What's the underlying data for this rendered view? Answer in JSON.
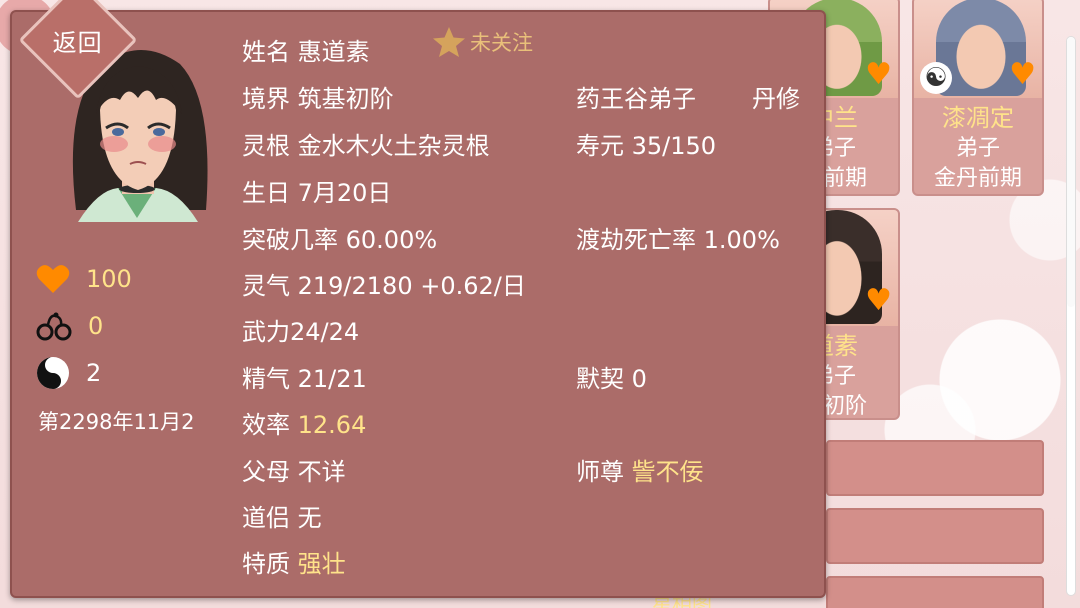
{
  "background": {
    "cards": [
      {
        "name": "中兰",
        "role": "弟子",
        "rank": "丹前期"
      },
      {
        "name": "漆凋定",
        "role": "弟子",
        "rank": "金丹前期"
      },
      {
        "name": "道素",
        "role": "弟子",
        "rank": "基初阶"
      }
    ],
    "bottom_peek": "星相图"
  },
  "panel": {
    "back_label": "返回",
    "follow_label": "未关注",
    "left_stats": {
      "favor": "100",
      "bond": "0",
      "daoyin": "2",
      "date": "第2298年11月2"
    },
    "info": {
      "name": "姓名 惠道素",
      "realm": "境界 筑基初阶",
      "sect": "药王谷弟子",
      "profession": "丹修",
      "root": "灵根 金水木火土杂灵根",
      "lifespan": "寿元 35/150",
      "birthday": "生日 7月20日",
      "breakthrough": "突破几率 60.00%",
      "tribulation": "渡劫死亡率 1.00%",
      "spirit": "灵气 219/2180 +0.62/日",
      "force": "武力24/24",
      "essence": "精气 21/21",
      "tacit": "默契 0",
      "efficiency_label": "效率",
      "efficiency_value": "12.64",
      "parents": "父母 不详",
      "master_label": "师尊",
      "master_value": "訾不佞",
      "partner": "道侣 无",
      "trait_label": "特质",
      "trait_value": "强壮"
    }
  },
  "colors": {
    "panel_bg": "#ab6c69",
    "gold_text": "#ffe38a",
    "heart": "#ff8a00"
  }
}
